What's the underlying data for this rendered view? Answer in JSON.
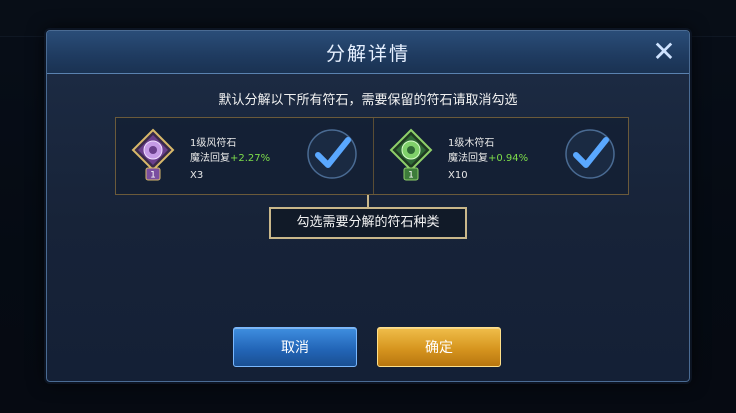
{
  "dialog": {
    "title": "分解详情",
    "close_icon": "close-icon",
    "subtitle": "默认分解以下所有符石，需要保留的符石请取消勾选"
  },
  "runes": [
    {
      "name": "1级风符石",
      "stat_label": "魔法回复",
      "stat_bonus": "+2.27%",
      "count": "X3",
      "level": "1",
      "icon": "wind-rune-icon",
      "checked": true,
      "accent": "#b06cd9"
    },
    {
      "name": "1级木符石",
      "stat_label": "魔法回复",
      "stat_bonus": "+0.94%",
      "count": "X10",
      "level": "1",
      "icon": "wood-rune-icon",
      "checked": true,
      "accent": "#5fbf4a"
    }
  ],
  "tooltip": "勾选需要分解的符石种类",
  "buttons": {
    "cancel": "取消",
    "confirm": "确定"
  },
  "colors": {
    "bonus_green": "#7ddc4a",
    "cancel_blue": "#2366b8",
    "confirm_gold": "#d6951f"
  }
}
